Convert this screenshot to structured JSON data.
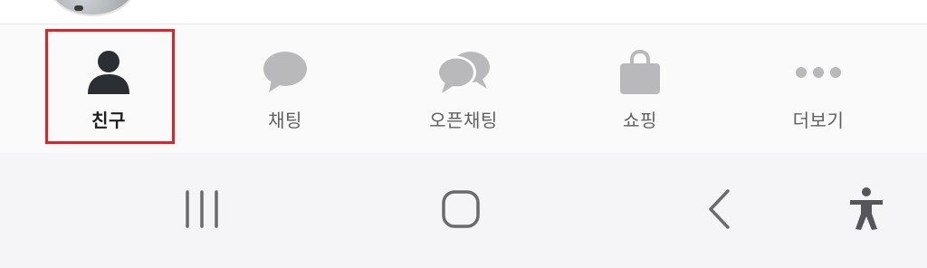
{
  "tabs": [
    {
      "id": "friends",
      "label": "친구",
      "icon": "person-icon",
      "active": true
    },
    {
      "id": "chats",
      "label": "채팅",
      "icon": "chat-bubble-icon",
      "active": false
    },
    {
      "id": "openchat",
      "label": "오픈채팅",
      "icon": "open-chat-bubbles-icon",
      "active": false
    },
    {
      "id": "shopping",
      "label": "쇼핑",
      "icon": "shopping-bag-icon",
      "active": false
    },
    {
      "id": "more",
      "label": "더보기",
      "icon": "more-dots-icon",
      "active": false
    }
  ],
  "system_nav": [
    {
      "id": "recents",
      "icon": "recent-apps-icon"
    },
    {
      "id": "home",
      "icon": "home-icon"
    },
    {
      "id": "back",
      "icon": "back-chevron-icon"
    },
    {
      "id": "accessibility",
      "icon": "accessibility-icon"
    }
  ],
  "colors": {
    "active_icon": "#2b2f33",
    "inactive_icon": "#b9b9bb",
    "highlight": "#d9252b",
    "nav_icon": "#6b6b6e"
  }
}
